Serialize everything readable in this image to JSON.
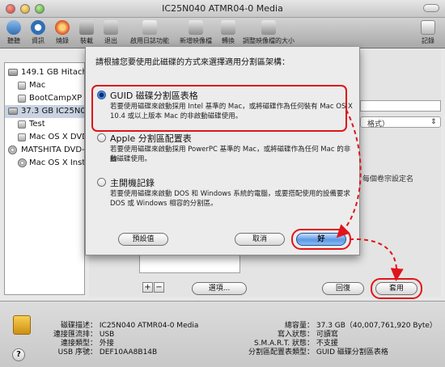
{
  "window": {
    "title": "IC25N040 ATMR04-0 Media"
  },
  "toolbar": {
    "items": [
      {
        "label": "聽聽",
        "icon": "info-icon"
      },
      {
        "label": "資訊",
        "icon": "info-icon"
      },
      {
        "label": "燒錄",
        "icon": "burn-icon"
      },
      {
        "label": "裝載",
        "icon": "mount-icon"
      },
      {
        "label": "退出",
        "icon": "eject-icon"
      },
      {
        "label": "啟用日誌功能",
        "icon": "journal-icon"
      },
      {
        "label": "新增映像檔",
        "icon": "new-image-icon"
      },
      {
        "label": "轉換",
        "icon": "convert-icon"
      },
      {
        "label": "調整映像檔的大小",
        "icon": "resize-image-icon"
      },
      {
        "label": "記錄",
        "icon": "log-icon"
      }
    ]
  },
  "sidebar": {
    "items": [
      {
        "label": "149.1 GB Hitachi H",
        "kind": "disk"
      },
      {
        "label": "Mac",
        "kind": "volume"
      },
      {
        "label": "BootCampXP",
        "kind": "volume"
      },
      {
        "label": "37.3 GB IC25N040",
        "kind": "disk"
      },
      {
        "label": "Test",
        "kind": "volume"
      },
      {
        "label": "Mac OS X DVD",
        "kind": "volume"
      },
      {
        "label": "MATSHITA DVD-R",
        "kind": "disc"
      },
      {
        "label": "Mac OS X Install",
        "kind": "volume"
      }
    ]
  },
  "background": {
    "format_suffix": "格式）",
    "hint_text": "每個卷宗設定名",
    "options_button": "選項...",
    "revert_button": "回復",
    "apply_button": "套用",
    "add_button": "+",
    "remove_button": "−"
  },
  "sheet": {
    "prompt": "請根據您要使用此磁碟的方式來選擇適用分割區架構：",
    "options": [
      {
        "title": "GUID 磁碟分割區表格",
        "selected": true,
        "desc_line1": "若要使用磁碟來啟動採用 Intel 基準的 Mac，或將磁碟作為任何裝有 Mac OS X",
        "desc_line2": "10.4 或以上版本 Mac 的非啟動磁碟使用。"
      },
      {
        "title": "Apple 分割區配置表",
        "selected": false,
        "desc_line1": "若要使用磁碟來啟動採用 PowerPC 基準的 Mac，或將磁碟作為任何 Mac 的非啟",
        "desc_line2": "動磁碟使用。"
      },
      {
        "title": "主開機記錄",
        "selected": false,
        "desc_line1": "若要使用磁碟來啟動 DOS 和 Windows 系統的電腦，或要搭配使用的設備要求",
        "desc_line2": "DOS 或 Windows 相容的分割區。"
      }
    ],
    "default_button": "預設值",
    "cancel_button": "取消",
    "ok_button": "好"
  },
  "info": {
    "left": [
      {
        "key": "磁碟描述：",
        "value": "IC25N040 ATMR04-0 Media"
      },
      {
        "key": "連接匯流排：",
        "value": "USB"
      },
      {
        "key": "連接類型：",
        "value": "外接"
      },
      {
        "key": "USB 序號：",
        "value": "DEF10AA8B14B"
      }
    ],
    "right": [
      {
        "key": "總容量：",
        "value": "37.3 GB（40,007,761,920 Byte）"
      },
      {
        "key": "寫入狀態：",
        "value": "可讀寫"
      },
      {
        "key": "S.M.A.R.T. 狀態：",
        "value": "不支援"
      },
      {
        "key": "分割區配置表類型：",
        "value": "GUID 磁碟分割區表格"
      }
    ]
  },
  "colors": {
    "highlight": "#e0141a",
    "selection": "#c9d3e2",
    "ok_blue": "#5b98e6"
  }
}
